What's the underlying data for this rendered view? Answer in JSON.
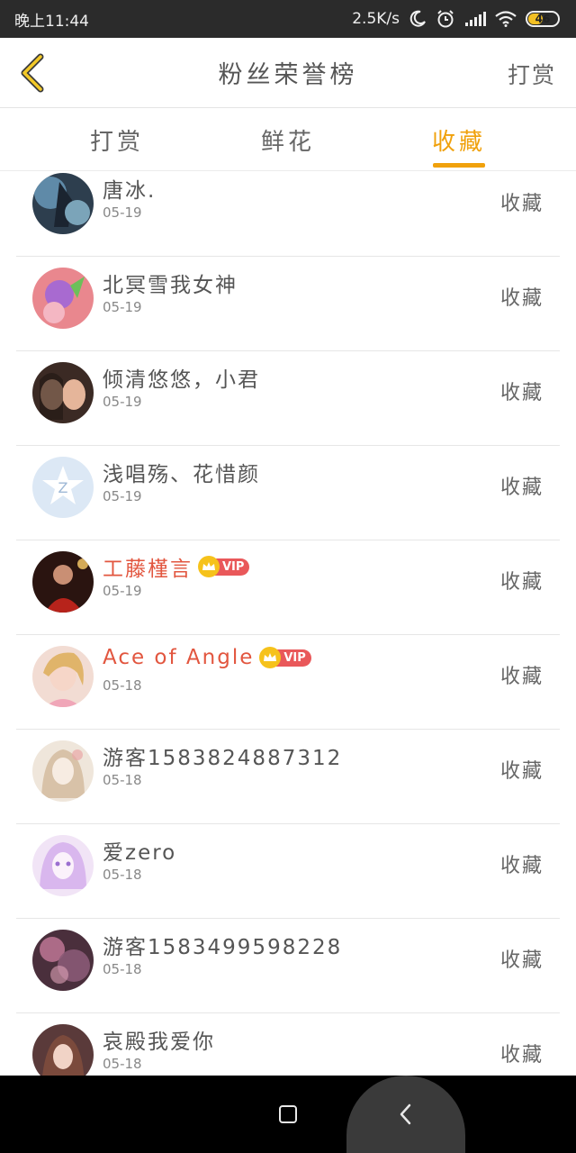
{
  "status_bar": {
    "time": "晚上11:44",
    "net_speed": "2.5K/s",
    "battery": "46",
    "icons": [
      "moon-icon",
      "alarm-icon",
      "signal-icon",
      "wifi-icon",
      "battery-icon"
    ]
  },
  "header": {
    "title": "粉丝荣誉榜",
    "action": "打赏",
    "back_icon": "chevron-left-icon"
  },
  "tabs": [
    {
      "label": "打赏",
      "active": false
    },
    {
      "label": "鲜花",
      "active": false
    },
    {
      "label": "收藏",
      "active": true
    }
  ],
  "colors": {
    "accent": "#f0a10c",
    "vip_name": "#e2563f",
    "vip_badge": "#e9585a",
    "crown": "#f6c21b"
  },
  "fans": [
    {
      "name": "唐冰.",
      "date": "05-19",
      "action": "收藏",
      "vip": false
    },
    {
      "name": "北冥雪我女神",
      "date": "05-19",
      "action": "收藏",
      "vip": false
    },
    {
      "name": "倾清悠悠，小君",
      "date": "05-19",
      "action": "收藏",
      "vip": false
    },
    {
      "name": "浅唱殇、花惜颜",
      "date": "05-19",
      "action": "收藏",
      "vip": false
    },
    {
      "name": "工藤槿言",
      "date": "05-19",
      "action": "收藏",
      "vip": true,
      "vip_label": "VIP"
    },
    {
      "name": "Ace of Angle",
      "date": "05-18",
      "action": "收藏",
      "vip": true,
      "vip_label": "VIP"
    },
    {
      "name": "游客1583824887312",
      "date": "05-18",
      "action": "收藏",
      "vip": false
    },
    {
      "name": "爱zero",
      "date": "05-18",
      "action": "收藏",
      "vip": false
    },
    {
      "name": "游客1583499598228",
      "date": "05-18",
      "action": "收藏",
      "vip": false
    },
    {
      "name": "哀殿我爱你",
      "date": "05-18",
      "action": "收藏",
      "vip": false
    }
  ],
  "nav_bar": {
    "icons": [
      "home-square-icon",
      "back-arrow-icon"
    ]
  }
}
